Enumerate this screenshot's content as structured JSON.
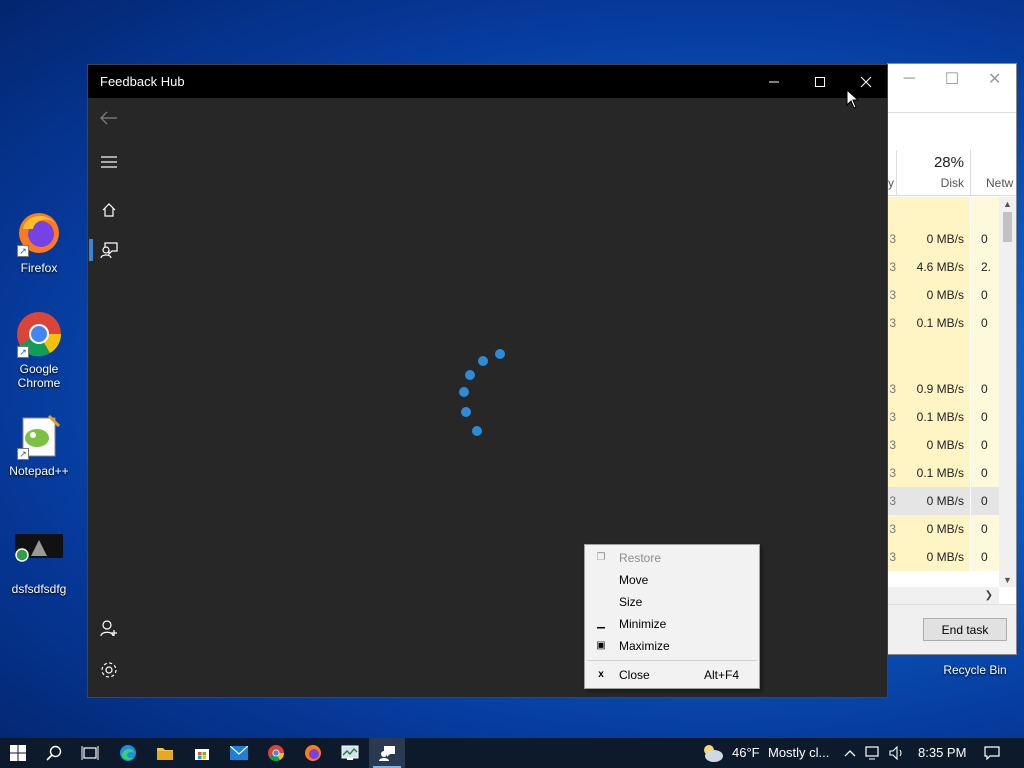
{
  "desktop": {
    "icons": [
      {
        "label": "Firefox"
      },
      {
        "label": "Google Chrome"
      },
      {
        "label": "Notepad++"
      },
      {
        "label": "dsfsdfsdfg"
      },
      {
        "label": "Recycle Bin"
      }
    ]
  },
  "task_manager": {
    "disk_percent": "28%",
    "disk_label": "Disk",
    "network_label": "Netw",
    "rows": [
      {
        "disk": "",
        "net": ""
      },
      {
        "disk": "0 MB/s",
        "net": "0"
      },
      {
        "disk": "4.6 MB/s",
        "net": "2."
      },
      {
        "disk": "0 MB/s",
        "net": "0"
      },
      {
        "disk": "0.1 MB/s",
        "net": "0"
      },
      {
        "disk": "",
        "net": ""
      },
      {
        "disk": "0.9 MB/s",
        "net": "0"
      },
      {
        "disk": "0.1 MB/s",
        "net": "0"
      },
      {
        "disk": "0 MB/s",
        "net": "0"
      },
      {
        "disk": "0.1 MB/s",
        "net": "0"
      },
      {
        "disk": "0 MB/s",
        "net": "0"
      },
      {
        "disk": "0 MB/s",
        "net": "0"
      },
      {
        "disk": "0 MB/s",
        "net": "0"
      }
    ],
    "end_task_label": "End task"
  },
  "feedback_hub": {
    "title": "Feedback Hub"
  },
  "context_menu": {
    "items": [
      {
        "label": "Restore",
        "shortcut": ""
      },
      {
        "label": "Move",
        "shortcut": ""
      },
      {
        "label": "Size",
        "shortcut": ""
      },
      {
        "label": "Minimize",
        "shortcut": ""
      },
      {
        "label": "Maximize",
        "shortcut": ""
      },
      {
        "label": "Close",
        "shortcut": "Alt+F4"
      }
    ]
  },
  "taskbar": {
    "weather_temp": "46°F",
    "weather_text": "Mostly cl...",
    "time": "8:35 PM"
  },
  "colors": {
    "accent": "#2e8bd6",
    "titlebar": "#000000",
    "app_background": "#272727"
  }
}
